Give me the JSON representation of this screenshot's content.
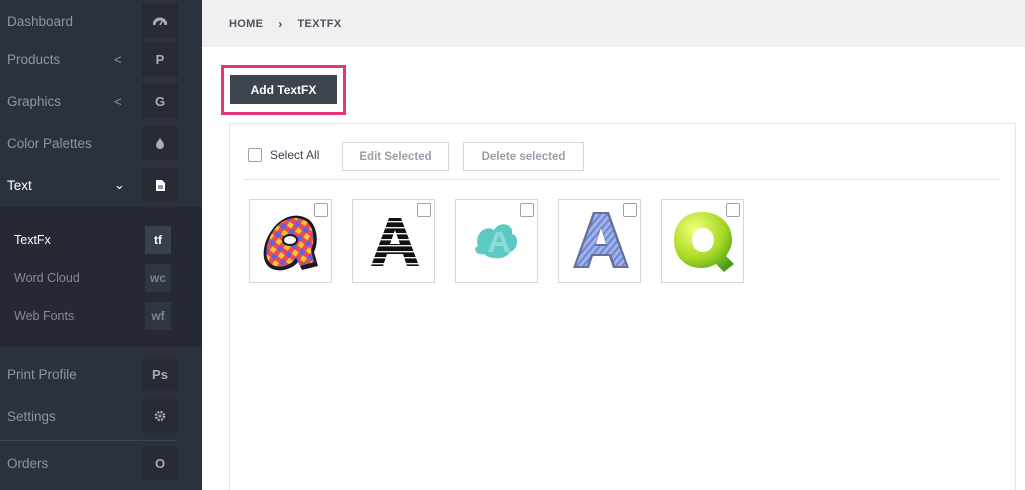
{
  "sidebar": {
    "items": [
      {
        "label": "Dashboard",
        "icon": "dashboard-icon",
        "chevron": ""
      },
      {
        "label": "Products",
        "icon": "P",
        "chevron": "<"
      },
      {
        "label": "Graphics",
        "icon": "G",
        "chevron": "<"
      },
      {
        "label": "Color Palettes",
        "icon": "drop-icon",
        "chevron": ""
      },
      {
        "label": "Text",
        "icon": "document-icon",
        "chevron": "⌄"
      }
    ],
    "submenu": [
      {
        "label": "TextFx",
        "icon": "tf"
      },
      {
        "label": "Word Cloud",
        "icon": "wc"
      },
      {
        "label": "Web Fonts",
        "icon": "wf"
      }
    ],
    "bottom_items": [
      {
        "label": "Print Profile",
        "icon": "Ps"
      },
      {
        "label": "Settings",
        "icon": "gear-icon"
      },
      {
        "label": "Orders",
        "icon": "O"
      }
    ]
  },
  "breadcrumb": {
    "home": "HOME",
    "separator": "›",
    "current": "TEXTFX"
  },
  "main": {
    "add_button": "Add TextFX",
    "select_all": "Select All",
    "edit_selected": "Edit Selected",
    "delete_selected": "Delete selected"
  },
  "thumbnails": [
    {
      "letter": "a",
      "style": "plaid"
    },
    {
      "letter": "A",
      "style": "black-striped"
    },
    {
      "letter": "A",
      "style": "teal-splash"
    },
    {
      "letter": "A",
      "style": "blue-scribble"
    },
    {
      "letter": "Q",
      "style": "green-gloss"
    }
  ],
  "colors": {
    "sidebar_bg": "#2c323d",
    "button_dark": "#3d4450",
    "highlight": "#e8337a"
  }
}
